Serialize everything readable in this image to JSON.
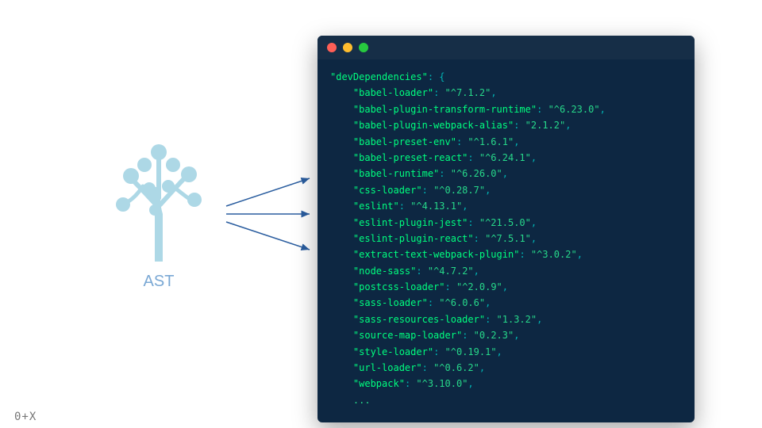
{
  "tree": {
    "label": "AST"
  },
  "terminal": {
    "header_key": "devDependencies",
    "entries": [
      {
        "k": "babel-loader",
        "v": "^7.1.2"
      },
      {
        "k": "babel-plugin-transform-runtime",
        "v": "^6.23.0"
      },
      {
        "k": "babel-plugin-webpack-alias",
        "v": "2.1.2"
      },
      {
        "k": "babel-preset-env",
        "v": "^1.6.1"
      },
      {
        "k": "babel-preset-react",
        "v": "^6.24.1"
      },
      {
        "k": "babel-runtime",
        "v": "^6.26.0"
      },
      {
        "k": "css-loader",
        "v": "^0.28.7"
      },
      {
        "k": "eslint",
        "v": "^4.13.1"
      },
      {
        "k": "eslint-plugin-jest",
        "v": "^21.5.0"
      },
      {
        "k": "eslint-plugin-react",
        "v": "^7.5.1"
      },
      {
        "k": "extract-text-webpack-plugin",
        "v": "^3.0.2"
      },
      {
        "k": "node-sass",
        "v": "^4.7.2"
      },
      {
        "k": "postcss-loader",
        "v": "^2.0.9"
      },
      {
        "k": "sass-loader",
        "v": "^6.0.6"
      },
      {
        "k": "sass-resources-loader",
        "v": "1.3.2"
      },
      {
        "k": "source-map-loader",
        "v": "0.2.3"
      },
      {
        "k": "style-loader",
        "v": "^0.19.1"
      },
      {
        "k": "url-loader",
        "v": "^0.6.2"
      },
      {
        "k": "webpack",
        "v": "^3.10.0"
      }
    ],
    "ellipsis": "..."
  },
  "footer": {
    "mark": "0+X"
  }
}
